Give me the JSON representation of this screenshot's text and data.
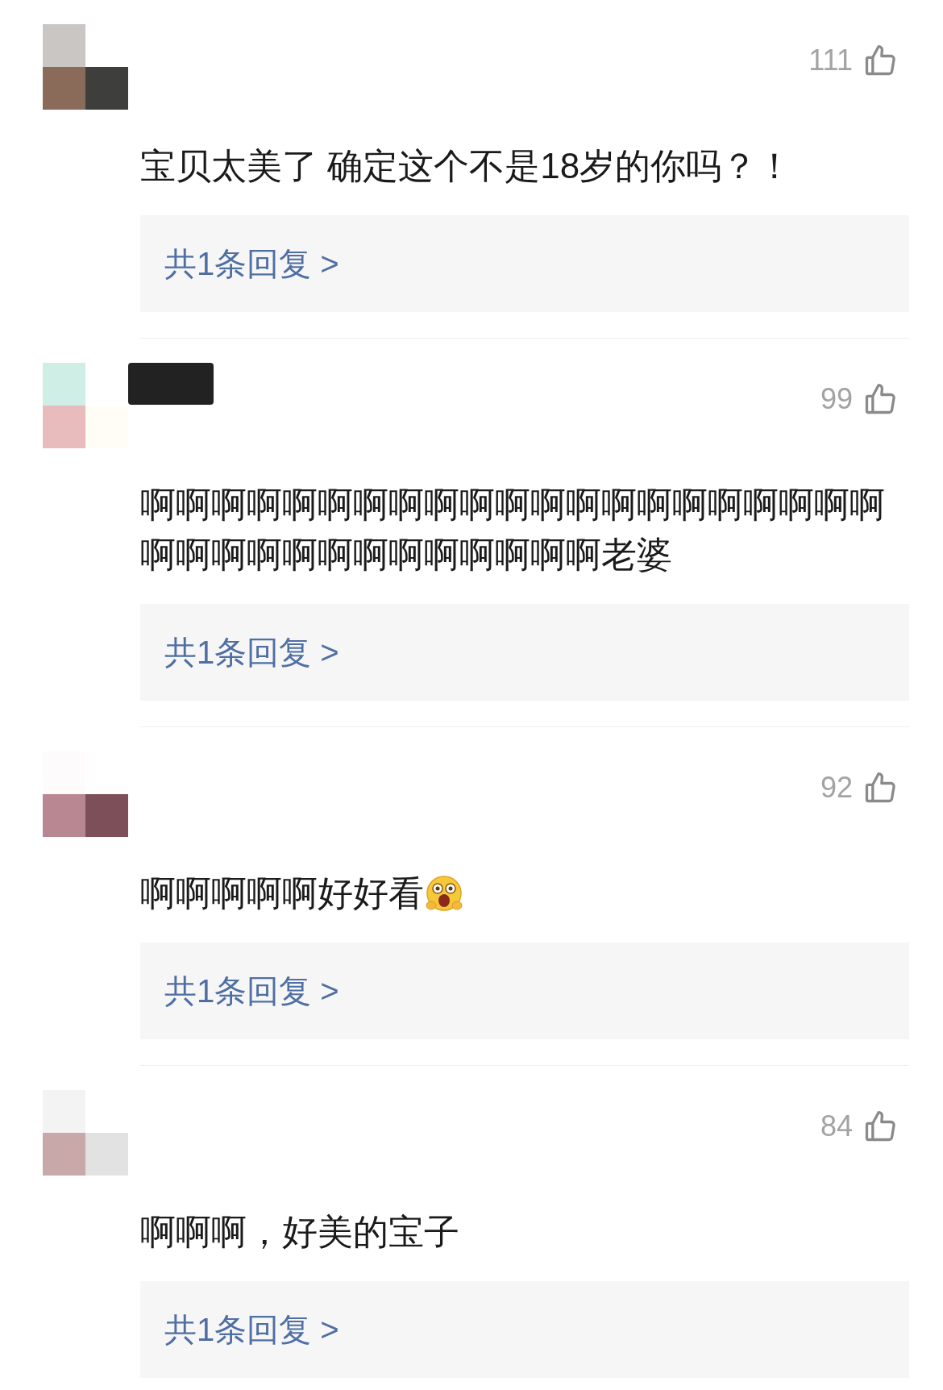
{
  "comments": [
    {
      "likes": "111",
      "text": "宝贝太美了 确定这个不是18岁的你吗？！",
      "emoji": false,
      "reply": "共1条回复 >",
      "name_hidden": false
    },
    {
      "likes": "99",
      "text": "啊啊啊啊啊啊啊啊啊啊啊啊啊啊啊啊啊啊啊啊啊啊啊啊啊啊啊啊啊啊啊啊啊啊老婆",
      "emoji": false,
      "reply": "共1条回复 >",
      "name_hidden": true
    },
    {
      "likes": "92",
      "text": "啊啊啊啊啊好好看",
      "emoji": true,
      "reply": "共1条回复 >",
      "name_hidden": false
    },
    {
      "likes": "84",
      "text": "啊啊啊，好美的宝子",
      "emoji": false,
      "reply": "共1条回复 >",
      "name_hidden": false
    }
  ]
}
